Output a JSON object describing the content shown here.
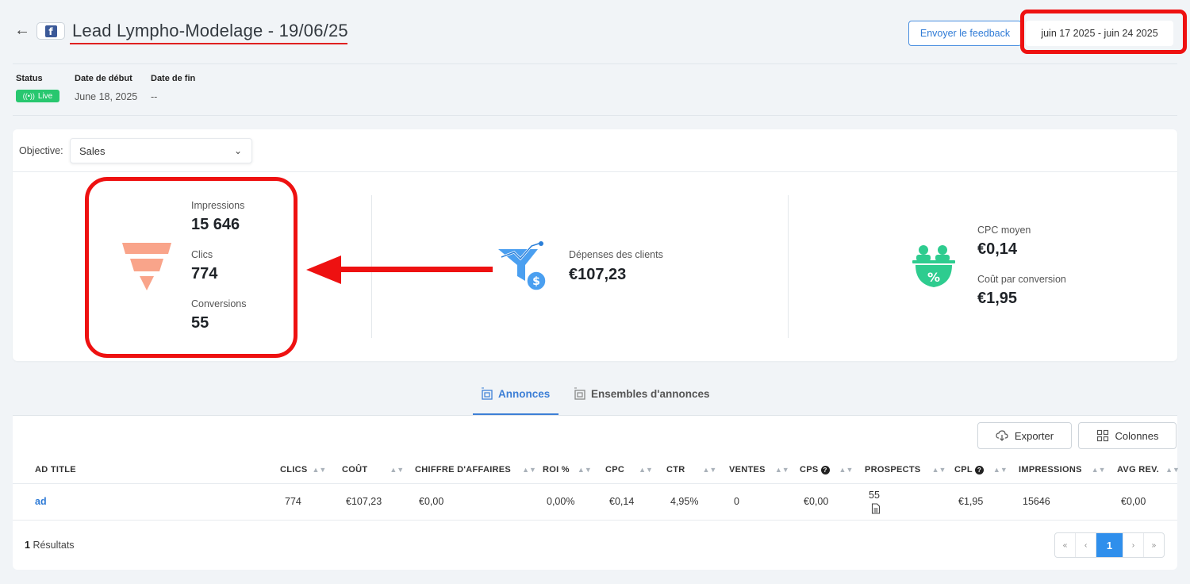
{
  "header": {
    "title": "Lead Lympho-Modelage - 19/06/25",
    "feedback_label": "Envoyer le feedback",
    "date_range": "juin 17 2025 - juin 24 2025"
  },
  "meta": {
    "status_label": "Status",
    "status_value": "Live",
    "start_label": "Date de début",
    "start_value": "June 18, 2025",
    "end_label": "Date de fin",
    "end_value": "--"
  },
  "objective": {
    "label": "Objective:",
    "value": "Sales"
  },
  "stats": {
    "impressions_label": "Impressions",
    "impressions_value": "15 646",
    "clicks_label": "Clics",
    "clicks_value": "774",
    "conversions_label": "Conversions",
    "conversions_value": "55",
    "spend_label": "Dépenses des clients",
    "spend_value": "€107,23",
    "cpc_label": "CPC moyen",
    "cpc_value": "€0,14",
    "cpa_label": "Coût par conversion",
    "cpa_value": "€1,95"
  },
  "tabs": {
    "ads": "Annonces",
    "adsets": "Ensembles d'annonces"
  },
  "toolbar": {
    "export_label": "Exporter",
    "columns_label": "Colonnes"
  },
  "table": {
    "headers": {
      "ad_title": "AD TITLE",
      "clics": "CLICS",
      "cout": "COÛT",
      "ca": "CHIFFRE D'AFFAIRES",
      "roi": "ROI %",
      "cpc": "CPC",
      "ctr": "CTR",
      "ventes": "VENTES",
      "cps": "CPS",
      "prospects": "PROSPECTS",
      "cpl": "CPL",
      "impressions": "IMPRESSIONS",
      "avg_rev": "AVG REV."
    },
    "row": {
      "ad_title": "ad",
      "clics": "774",
      "cout": "€107,23",
      "ca": "€0,00",
      "roi": "0,00%",
      "cpc": "€0,14",
      "ctr": "4,95%",
      "ventes": "0",
      "cps": "€0,00",
      "prospects": "55",
      "cpl": "€1,95",
      "impressions": "15646",
      "avg_rev": "€0,00"
    }
  },
  "footer": {
    "results_count": "1",
    "results_label": "Résultats",
    "pager_first": "«",
    "pager_prev": "‹",
    "pager_current": "1",
    "pager_next": "›",
    "pager_last": "»"
  },
  "colors": {
    "accent": "#3d7fd6",
    "live": "#28c76f",
    "funnel": "#f9a48a",
    "spend_icon": "#4a9ff0",
    "cpc_icon": "#2ecc8f",
    "annotation": "#ee1111"
  }
}
